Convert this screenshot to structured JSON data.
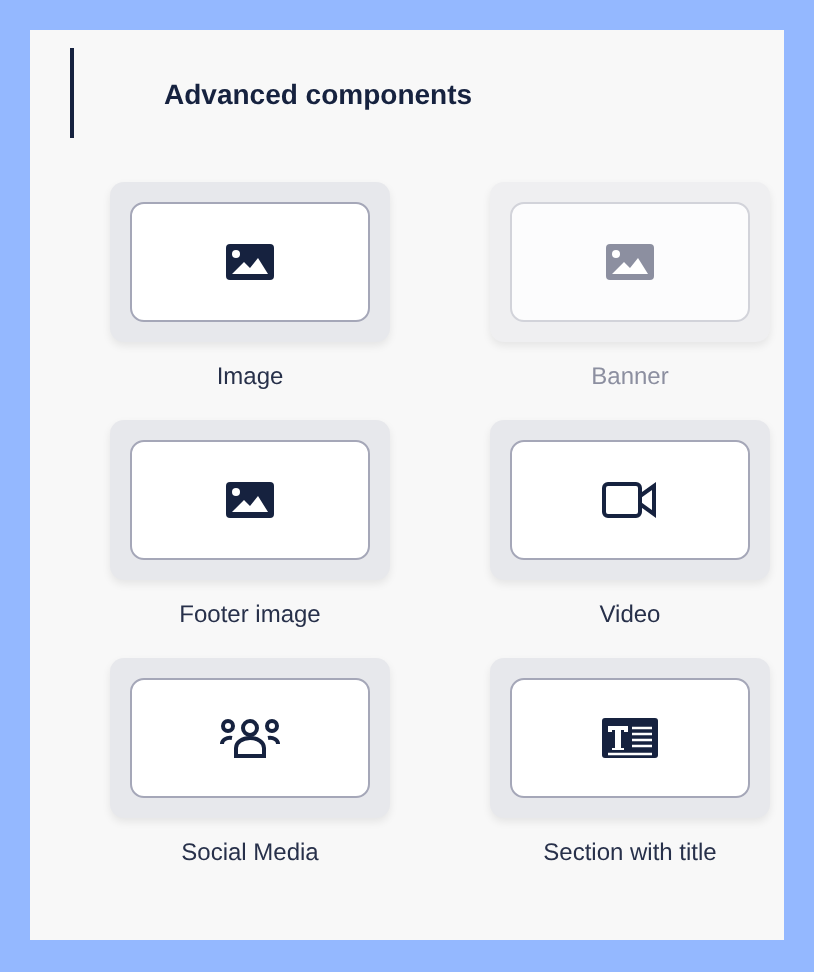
{
  "section": {
    "title": "Advanced components"
  },
  "components": [
    {
      "label": "Image",
      "kind": "image",
      "disabled": false
    },
    {
      "label": "Banner",
      "kind": "image",
      "disabled": true
    },
    {
      "label": "Footer image",
      "kind": "image",
      "disabled": false
    },
    {
      "label": "Video",
      "kind": "video",
      "disabled": false
    },
    {
      "label": "Social Media",
      "kind": "people",
      "disabled": false
    },
    {
      "label": "Section with title",
      "kind": "titled-text",
      "disabled": false
    }
  ]
}
